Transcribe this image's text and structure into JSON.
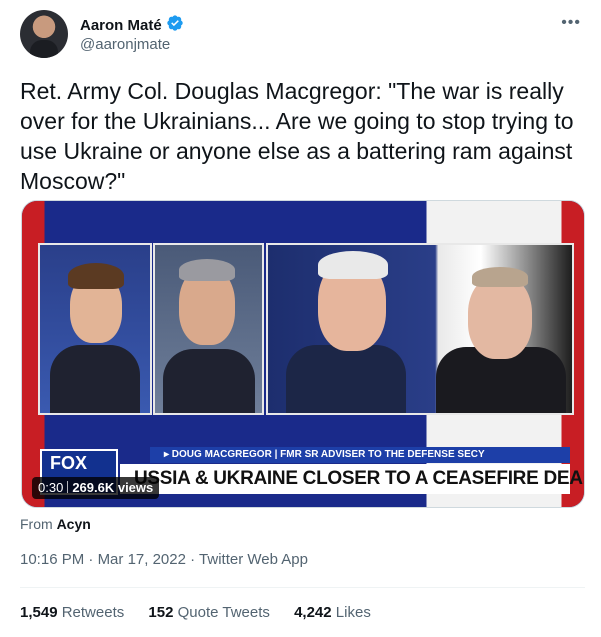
{
  "author": {
    "name": "Aaron Maté",
    "handle": "@aaronjmate",
    "verified": true
  },
  "tweet": {
    "text": "Ret. Army Col. Douglas Macgregor: \"The war is really over for the Ukrainians... Are we going to stop trying to use Ukraine or anyone else as a battering ram against Moscow?\""
  },
  "media": {
    "lower_third_top": "▸ DOUG MACGREGOR | FMR SR ADVISER TO THE DEFENSE SECY",
    "lower_third_main": "USSIA & UKRAINE CLOSER TO A CEASEFIRE DEAL?",
    "network_logo": "FOX",
    "duration": "0:30",
    "views": "269.6K views"
  },
  "source": {
    "label": "From",
    "account": "Acyn"
  },
  "meta": {
    "time": "10:16 PM",
    "date": "Mar 17, 2022",
    "app": "Twitter Web App",
    "separator": "·"
  },
  "stats": {
    "retweets_count": "1,549",
    "retweets_label": "Retweets",
    "quotes_count": "152",
    "quotes_label": "Quote Tweets",
    "likes_count": "4,242",
    "likes_label": "Likes"
  },
  "colors": {
    "verified": "#1d9bf0",
    "secondary_text": "#536471",
    "fox_blue": "#12318f"
  },
  "icons": [
    "verified-badge-icon",
    "more-options-icon"
  ]
}
